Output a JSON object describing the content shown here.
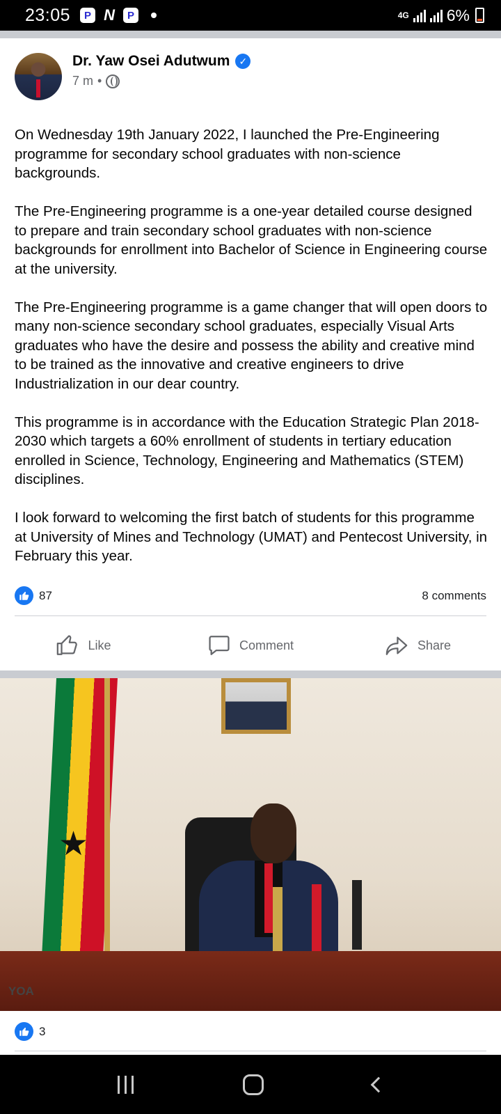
{
  "status_bar": {
    "time": "23:05",
    "app_icons": [
      "p-app-icon",
      "n-app-icon",
      "p-app-icon"
    ],
    "network": "4G",
    "battery": "6%"
  },
  "post": {
    "author": "Dr. Yaw Osei Adutwum",
    "time_ago": "7 m",
    "meta_separator": "•",
    "paragraphs": [
      "On Wednesday 19th January 2022, I launched the Pre-Engineering programme for secondary school graduates with non-science backgrounds.",
      "The Pre-Engineering programme is a one-year detailed course designed to prepare and train secondary school graduates with non-science backgrounds for enrollment into Bachelor of Science in Engineering course at the university.",
      "The Pre-Engineering programme is a game changer that will open doors to many non-science secondary school graduates, especially Visual Arts graduates who have the desire and possess the ability and creative mind to be trained as the innovative and creative engineers to drive Industrialization in our dear country.",
      "This programme is in accordance with the Education Strategic Plan 2018-2030 which targets a 60% enrollment of students in tertiary education enrolled in Science, Technology, Engineering and Mathematics (STEM) disciplines.",
      "I look forward to welcoming the first batch of students for this programme at University of Mines and Technology (UMAT) and Pentecost University, in February this year."
    ],
    "like_count": "87",
    "comment_count": "8 comments",
    "actions": {
      "like": "Like",
      "comment": "Comment",
      "share": "Share"
    }
  },
  "photo": {
    "watermark": "YOA",
    "like_count": "3"
  },
  "colors": {
    "accent": "#1877f2",
    "secondary_text": "#65676b",
    "divider": "#c9ccd1"
  }
}
